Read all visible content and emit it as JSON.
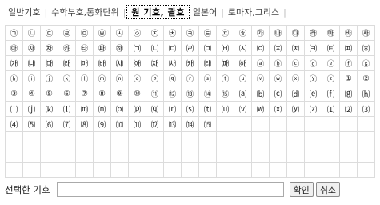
{
  "tabs": [
    {
      "label": "일반기호",
      "active": false
    },
    {
      "label": "수학부호,통화단위",
      "active": false
    },
    {
      "label": "원 기호, 괄호",
      "active": true
    },
    {
      "label": "일본어",
      "active": false
    },
    {
      "label": "로마자,그리스",
      "active": false
    }
  ],
  "symbols": [
    [
      "㉠",
      "㉡",
      "㉢",
      "㉣",
      "㉤",
      "㉥",
      "㉦",
      "㉧",
      "㉨",
      "㉩",
      "㉪",
      "㉫",
      "㉬",
      "㉭",
      "㉮",
      "㉯",
      "㉰",
      "㉱",
      "㉲",
      "㉳",
      "㉴"
    ],
    [
      "㉵",
      "㉶",
      "㉷",
      "㉸",
      "㉹",
      "㉺",
      "㉻",
      "㈀",
      "㈁",
      "㈂",
      "㈃",
      "㈄",
      "㈅",
      "㈆",
      "㈇",
      "㈈",
      "㈉",
      "㈊",
      "㈋",
      "㈌",
      "㈍"
    ],
    [
      "㈎",
      "㈏",
      "㈐",
      "㈑",
      "㈒",
      "㈓",
      "㈔",
      "㈕",
      "㈖",
      "㈗",
      "㈘",
      "㈙",
      "㈚",
      "㈛",
      "ⓐ",
      "ⓑ",
      "ⓒ",
      "ⓓ",
      "ⓔ",
      "ⓕ",
      "ⓖ"
    ],
    [
      "ⓗ",
      "ⓘ",
      "ⓙ",
      "ⓚ",
      "ⓛ",
      "ⓜ",
      "ⓝ",
      "ⓞ",
      "ⓟ",
      "ⓠ",
      "ⓡ",
      "ⓢ",
      "ⓣ",
      "ⓤ",
      "ⓥ",
      "ⓦ",
      "ⓧ",
      "ⓨ",
      "ⓩ",
      "①",
      "②"
    ],
    [
      "③",
      "④",
      "⑤",
      "⑥",
      "⑦",
      "⑧",
      "⑨",
      "⑩",
      "⑪",
      "⑫",
      "⑬",
      "⑭",
      "⑮",
      "⒜",
      "⒝",
      "⒞",
      "⒟",
      "⒠",
      "⒡",
      "⒢",
      "⒣"
    ],
    [
      "⒤",
      "⒥",
      "⒦",
      "⒧",
      "⒨",
      "⒩",
      "⒪",
      "⒫",
      "⒬",
      "⒭",
      "⒮",
      "⒯",
      "⒰",
      "⒱",
      "⒲",
      "⒳",
      "⒴",
      "⒵",
      "⑴",
      "⑵",
      "⑶"
    ],
    [
      "⑷",
      "⑸",
      "⑹",
      "⑺",
      "⑻",
      "⑼",
      "⑽",
      "⑾",
      "⑿",
      "⒀",
      "⒁",
      "⒂",
      "",
      "",
      "",
      "",
      "",
      "",
      "",
      "",
      ""
    ],
    [
      "",
      "",
      "",
      "",
      "",
      "",
      "",
      "",
      "",
      "",
      "",
      "",
      "",
      "",
      "",
      "",
      "",
      "",
      "",
      "",
      ""
    ],
    [
      "",
      "",
      "",
      "",
      "",
      "",
      "",
      "",
      "",
      "",
      "",
      "",
      "",
      "",
      "",
      "",
      "",
      "",
      "",
      "",
      ""
    ],
    [
      "",
      "",
      "",
      "",
      "",
      "",
      "",
      "",
      "",
      "",
      "",
      "",
      "",
      "",
      "",
      "",
      "",
      "",
      "",
      "",
      ""
    ]
  ],
  "bottom": {
    "label": "선택한 기호",
    "input_value": "",
    "confirm_label": "확인",
    "cancel_label": "취소"
  }
}
